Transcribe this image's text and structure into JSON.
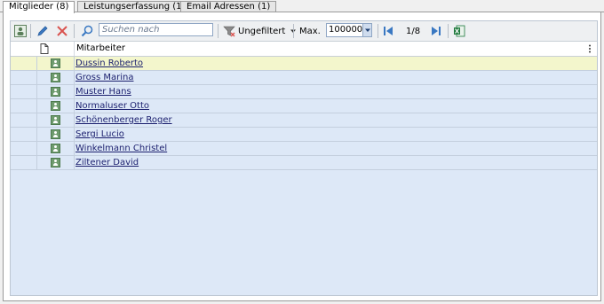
{
  "tabs": [
    {
      "label": "Mitglieder (8)",
      "active": true
    },
    {
      "label": "Leistungserfassung (1)",
      "active": false
    },
    {
      "label": "Email Adressen (1)",
      "active": false
    }
  ],
  "toolbar": {
    "search_placeholder": "Suchen nach",
    "filter_label": "Ungefiltert",
    "max_label": "Max.",
    "max_value": "100000",
    "page_label": "1/8"
  },
  "grid": {
    "column_header": "Mitarbeiter",
    "rows": [
      {
        "name": "Dussin Roberto",
        "selected": true
      },
      {
        "name": "Gross Marina"
      },
      {
        "name": "Muster Hans"
      },
      {
        "name": "Normaluser Otto"
      },
      {
        "name": "Schönenberger Roger"
      },
      {
        "name": "Sergi Lucio"
      },
      {
        "name": "Winkelmann Christel"
      },
      {
        "name": "Ziltener David"
      }
    ]
  },
  "colors": {
    "selected_row": "#f3f6cc",
    "row_bg": "#dde8f7",
    "link": "#1b1f6e",
    "nav_blue": "#3a78c2",
    "delete_red": "#d9534f",
    "excel_green": "#1f7a3d"
  }
}
